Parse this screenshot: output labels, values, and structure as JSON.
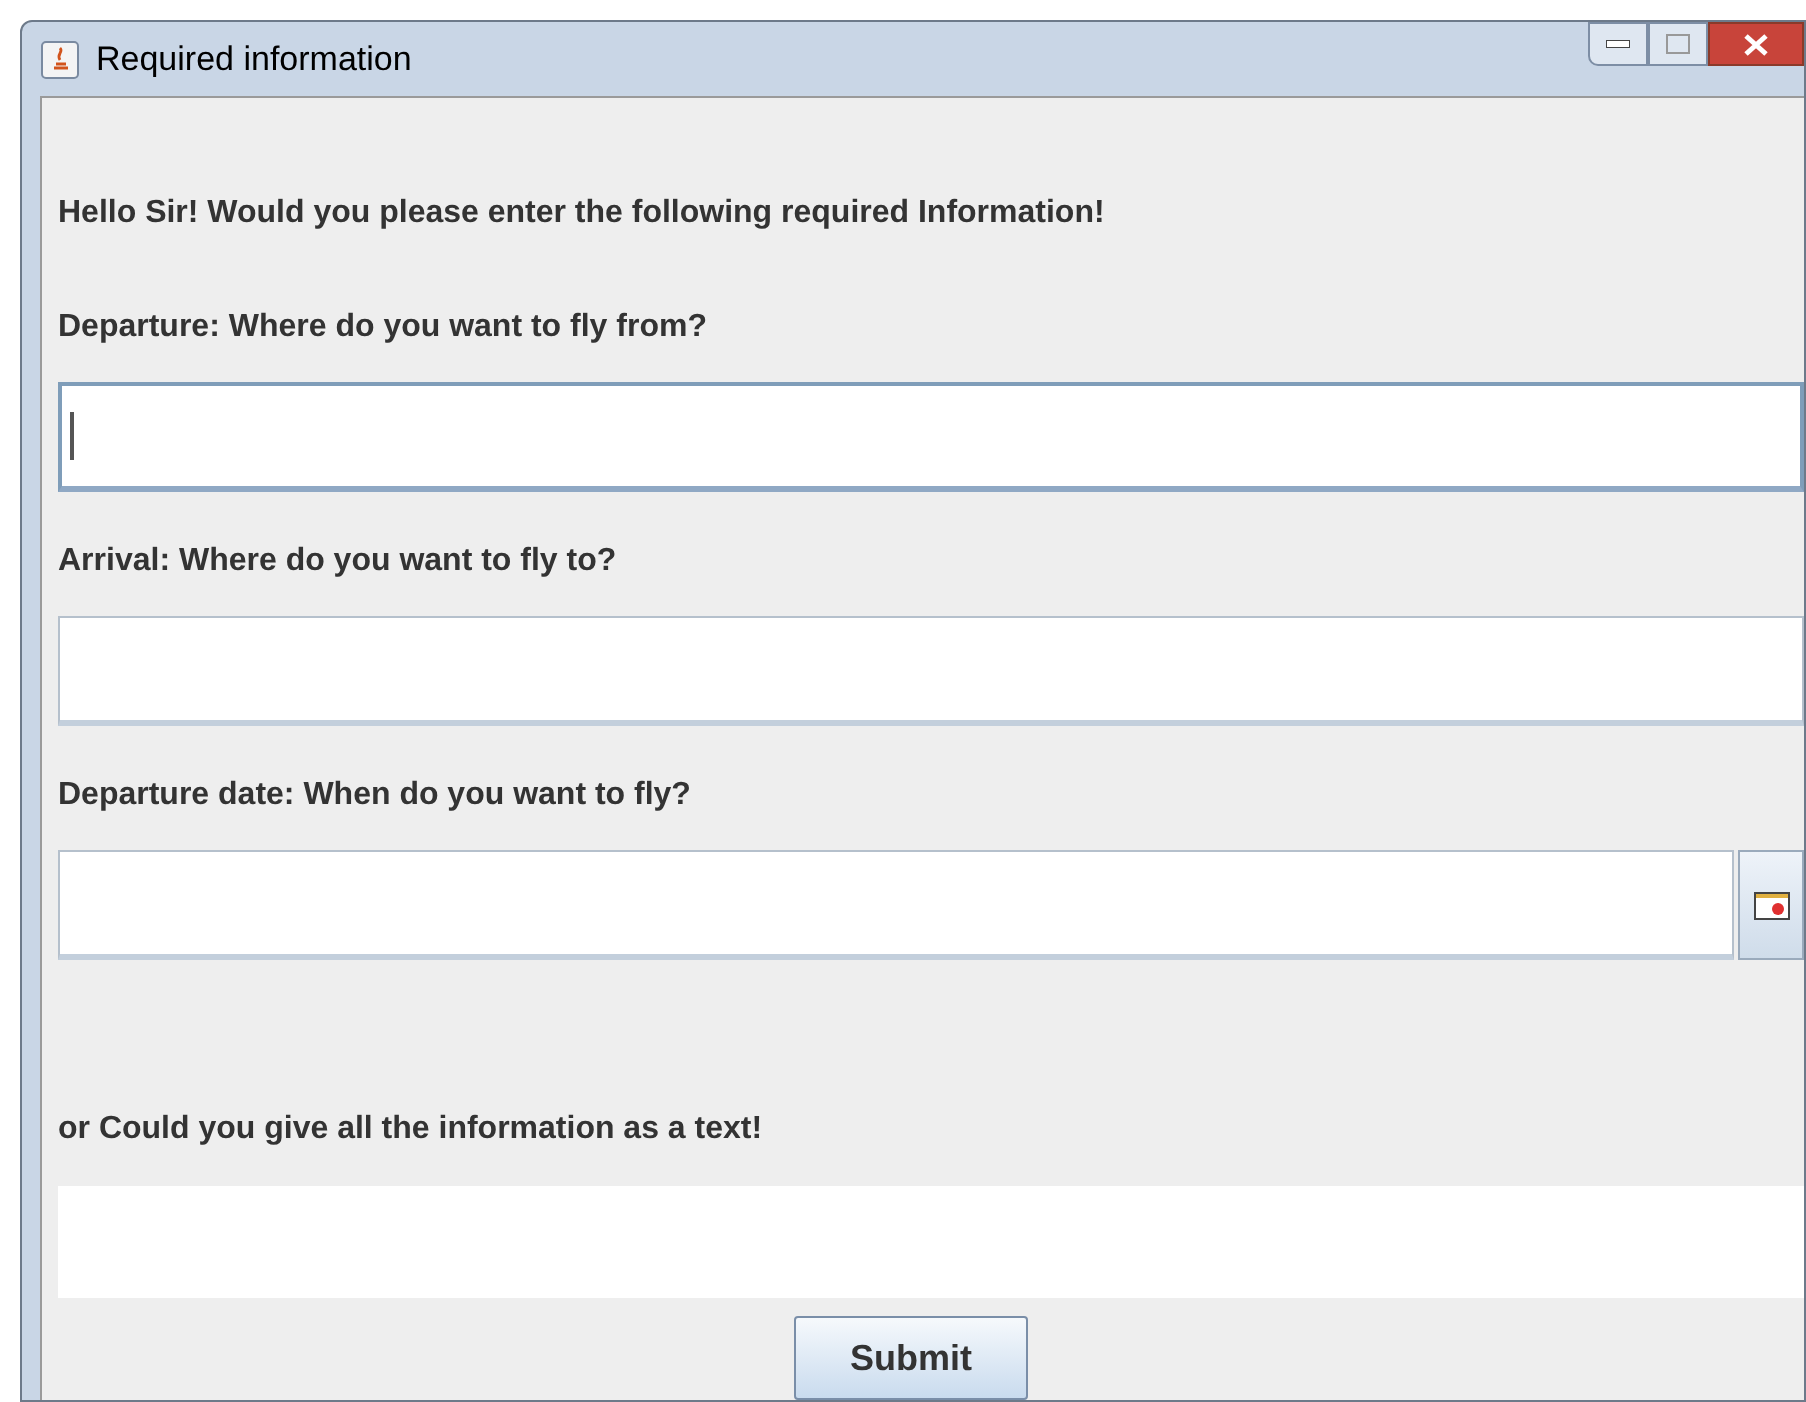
{
  "window": {
    "title": "Required information"
  },
  "intro": "Hello Sir! Would you please enter the following required Information!",
  "fields": [
    {
      "label": "Departure: Where do you want to fly from?",
      "kind": "text",
      "focused": true
    },
    {
      "label": "Arrival: Where do you want to fly to?",
      "kind": "text",
      "focused": false
    },
    {
      "label": "Departure date: When do you want to fly?",
      "kind": "date",
      "focused": false
    }
  ],
  "free_text": {
    "label": "or Could you give all the information as a text!"
  },
  "submit": "Submit"
}
